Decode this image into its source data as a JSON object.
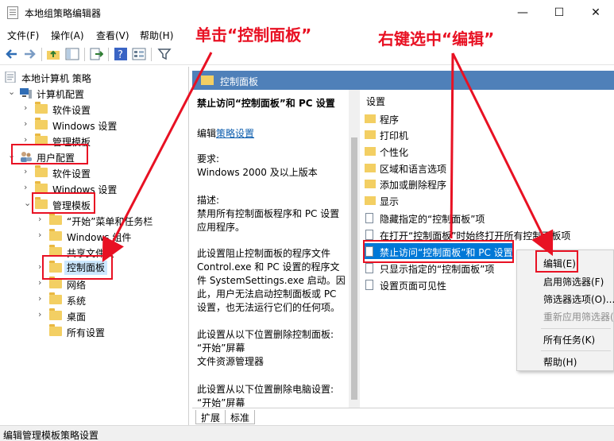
{
  "window": {
    "title": "本地组策略编辑器",
    "controls": {
      "minimize": "—",
      "maximize": "☐",
      "close": "✕"
    }
  },
  "menubar": [
    "文件(F)",
    "操作(A)",
    "查看(V)",
    "帮助(H)"
  ],
  "toolbar_icons": [
    "back-icon",
    "forward-icon",
    "up-folder-icon",
    "show-hide-tree-icon",
    "export-icon",
    "help-icon",
    "properties-icon",
    "filter-icon"
  ],
  "tree": {
    "root": "本地计算机 策略",
    "computer_config": "计算机配置",
    "cc_software": "软件设置",
    "cc_windows": "Windows 设置",
    "cc_admin": "管理模板",
    "user_config": "用户配置",
    "uc_software": "软件设置",
    "uc_windows": "Windows 设置",
    "uc_admin": "管理模板",
    "start_menu": "“开始”菜单和任务栏",
    "windows_components": "Windows 组件",
    "shared_folders": "共享文件夹",
    "control_panel": "控制面板",
    "network": "网络",
    "system": "系统",
    "desktop": "桌面",
    "all_settings": "所有设置"
  },
  "right_header": "控制面板",
  "description": {
    "heading": "禁止访问“控制面板”和 PC 设置",
    "edit_prefix": "编辑",
    "edit_link": "策略设置",
    "req_label": "要求:",
    "req_value": "Windows 2000 及以上版本",
    "desc_label": "描述:",
    "desc_1": "禁用所有控制面板程序和 PC 设置",
    "desc_2": "应用程序。",
    "p2_1": "此设置阻止控制面板的程序文件",
    "p2_2": "Control.exe 和 PC 设置的程序文",
    "p2_3": "件 SystemSettings.exe 启动。因",
    "p2_4": "此，用户无法启动控制面板或 PC",
    "p2_5": "设置，也无法运行它们的任何项。",
    "p3_1": "此设置从以下位置删除控制面板:",
    "p3_2": "“开始”屏幕",
    "p3_3": "文件资源管理器",
    "p4_1": "此设置从以下位置删除电脑设置:",
    "p4_2": "“开始”屏幕"
  },
  "settings": {
    "column_header": "设置",
    "items": [
      "程序",
      "打印机",
      "个性化",
      "区域和语言选项",
      "添加或删除程序",
      "显示",
      "隐藏指定的“控制面板”项",
      "在打开“控制面板”时始终打开所有控制面板项",
      "禁止访问“控制面板”和 PC 设置",
      "只显示指定的“控制面板”项",
      "设置页面可见性"
    ]
  },
  "context_menu": {
    "edit": "编辑(E)",
    "enable_filter": "启用筛选器(F)",
    "filter_options": "筛选器选项(O)...",
    "reapply_filter": "重新应用筛选器(",
    "all_tasks": "所有任务(K)",
    "help": "帮助(H)"
  },
  "tabs": [
    "扩展",
    "标准"
  ],
  "status_text": "编辑管理模板策略设置",
  "annotations": {
    "left_text": "单击“控制面板”",
    "right_text": "右键选中“编辑”",
    "color": "#e81123"
  }
}
